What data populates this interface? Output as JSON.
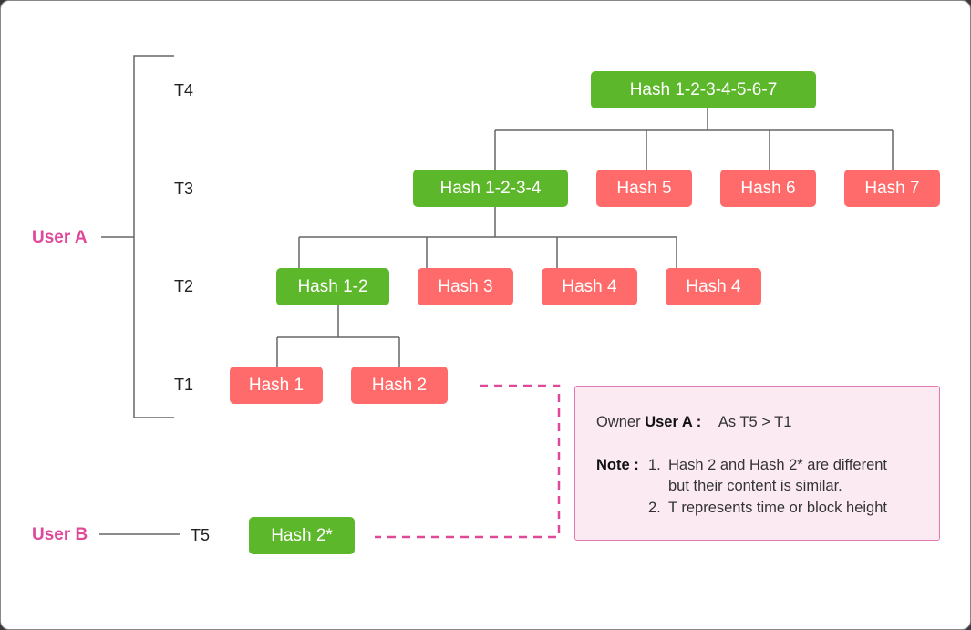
{
  "colors": {
    "green": "#5cb82a",
    "red": "#ff6b6b",
    "user": "#e0499a",
    "line": "#666666",
    "note_bg": "#fceaf3"
  },
  "time_labels": {
    "t1": "T1",
    "t2": "T2",
    "t3": "T3",
    "t4": "T4",
    "t5": "T5"
  },
  "users": {
    "a": "User A",
    "b": "User B"
  },
  "nodes": {
    "root": "Hash 1-2-3-4-5-6-7",
    "h1234": "Hash 1-2-3-4",
    "h5": "Hash 5",
    "h6": "Hash 6",
    "h7": "Hash 7",
    "h12": "Hash 1-2",
    "h3": "Hash 3",
    "h4a": "Hash 4",
    "h4b": "Hash 4",
    "h1": "Hash 1",
    "h2": "Hash 2",
    "h2star": "Hash 2*"
  },
  "note": {
    "owner_prefix": "Owner",
    "owner_user": "User A :",
    "owner_reason": "As T5 > T1",
    "note_label": "Note :",
    "item1_num": "1.",
    "item1_line1": "Hash 2 and Hash 2* are different",
    "item1_line2": "but their content is similar.",
    "item2_num": "2.",
    "item2_text": "T represents time or block height"
  }
}
